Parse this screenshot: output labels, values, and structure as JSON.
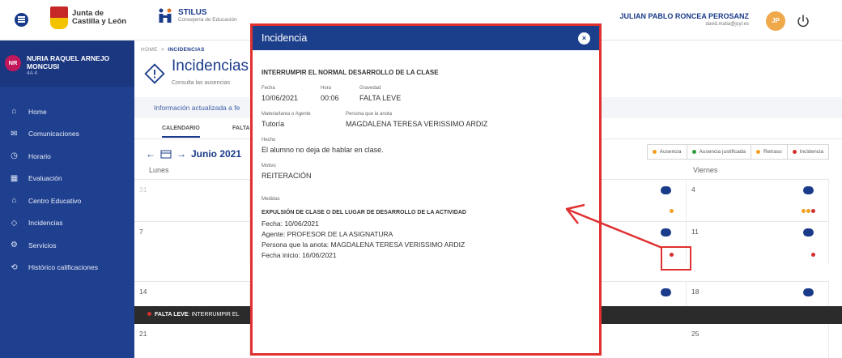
{
  "header": {
    "org_line1": "Junta de",
    "org_line2": "Castilla y León",
    "app_name": "STILUS",
    "app_sub": "Consejería de Educación",
    "user_name": "JULIAN PABLO RONCEA PEROSANZ",
    "user_email": "david.matia@jcyl.es",
    "user_initials": "JP"
  },
  "sidebar": {
    "student_initials": "NR",
    "student_name": "NURIA RAQUEL ARNEJO MONCUSI",
    "student_class": "4A 4",
    "items": [
      {
        "label": "Home",
        "icon": "home-icon",
        "glyph": "⌂"
      },
      {
        "label": "Comunicaciones",
        "icon": "chat-icon",
        "glyph": "✉"
      },
      {
        "label": "Horario",
        "icon": "clock-icon",
        "glyph": "◷"
      },
      {
        "label": "Evaluación",
        "icon": "grade-icon",
        "glyph": "▦"
      },
      {
        "label": "Centro Educativo",
        "icon": "school-icon",
        "glyph": "⌂"
      },
      {
        "label": "Incidencias",
        "icon": "warning-icon",
        "glyph": "◇"
      },
      {
        "label": "Servicios",
        "icon": "gear-icon",
        "glyph": "⚙"
      },
      {
        "label": "Histórico calificaciones",
        "icon": "history-icon",
        "glyph": "⟲"
      }
    ]
  },
  "main": {
    "breadcrumb_home": "HOME",
    "breadcrumb_sep": ">",
    "breadcrumb_current": "INCIDENCIAS",
    "title": "Incidencias",
    "subtitle": "Consulta las ausencias",
    "info_text": "Información actualizada a fe",
    "tab_calendar": "CALENDARIO",
    "tab_second": "FALTA",
    "month_label": "Junio 2021",
    "legend": [
      {
        "label": "Ausencia",
        "color": "#f0a020"
      },
      {
        "label": "Ausencia justificada",
        "color": "#2e9e3e"
      },
      {
        "label": "Retraso",
        "color": "#f0a020"
      },
      {
        "label": "Incidencia",
        "color": "#d32f2f"
      }
    ],
    "day_monday": "Lunes",
    "day_friday": "Viernes",
    "days": {
      "d31": "31",
      "d4": "4",
      "d7": "7",
      "d11": "11",
      "d14": "14",
      "d18": "18",
      "d21": "21",
      "d25": "25"
    },
    "dark_bar_label": "FALTA LEVE",
    "dark_bar_text": ": INTERRUMPIR EL"
  },
  "modal": {
    "title": "Incidencia",
    "close_glyph": "×",
    "heading": "INTERRUMPIR EL NORMAL DESARROLLO DE LA CLASE",
    "fecha_label": "Fecha",
    "fecha_value": "10/06/2021",
    "hora_label": "Hora",
    "hora_value": "00:06",
    "gravedad_label": "Gravedad",
    "gravedad_value": "FALTA LEVE",
    "materia_label": "Materia/tarea o Agente",
    "materia_value": "Tutoría",
    "persona_label": "Persona que la anota",
    "persona_value": "MAGDALENA TERESA VERISSIMO ARDIZ",
    "hecho_label": "Hecho",
    "hecho_value": "El alumno no deja de hablar en clase.",
    "motivo_label": "Motivo",
    "motivo_value": "REITERACIÓN",
    "medidas_label": "Medidas",
    "medida_title": "EXPULSIÓN DE CLASE O DEL LUGAR DE DESARROLLO DE LA ACTIVIDAD",
    "medida_fecha": "Fecha: 10/06/2021",
    "medida_agente": "Agente: PROFESOR DE LA ASIGNATURA",
    "medida_persona": "Persona que la anota: MAGDALENA TERESA VERISSIMO ARDIZ",
    "medida_inicio": "Fecha inicio: 16/06/2021"
  },
  "colors": {
    "brand_blue": "#1c3f8c",
    "annotation_red": "#e03030",
    "incidence_red": "#d32f2f",
    "retraso_orange": "#f0a020"
  }
}
